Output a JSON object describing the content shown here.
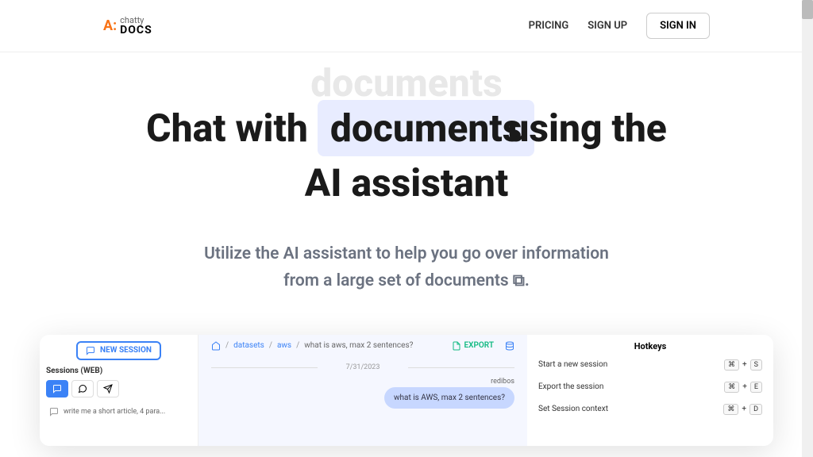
{
  "brand": {
    "chatty": "chatty",
    "docs": "DOCS"
  },
  "nav": {
    "pricing": "PRICING",
    "signup": "SIGN UP",
    "signin": "SIGN IN"
  },
  "hero": {
    "ghost": "documents",
    "headline_pre": "Chat with ",
    "headline_highlight": "documents",
    "headline_overlap": "using the",
    "headline_line2": "AI assistant",
    "subhead_line1": "Utilize the AI assistant to help you go over information",
    "subhead_line2_pre": "from a large set of documents ",
    "subhead_line2_post": "."
  },
  "preview": {
    "left": {
      "new_session": "NEW SESSION",
      "sessions_label": "Sessions (WEB)",
      "session_item": "write me a short article, 4 para..."
    },
    "mid": {
      "breadcrumb": {
        "datasets": "datasets",
        "aws": "aws",
        "current": "what is aws, max 2 sentences?"
      },
      "export": "EXPORT",
      "date": "7/31/2023",
      "user": "redibos",
      "message": "what is AWS, max 2 sentences?"
    },
    "right": {
      "title": "Hotkeys",
      "rows": [
        {
          "label": "Start a new session",
          "keys": [
            "⌘",
            "+",
            "S"
          ]
        },
        {
          "label": "Export the session",
          "keys": [
            "⌘",
            "+",
            "E"
          ]
        },
        {
          "label": "Set Session context",
          "keys": [
            "⌘",
            "+",
            "D"
          ]
        }
      ]
    }
  }
}
